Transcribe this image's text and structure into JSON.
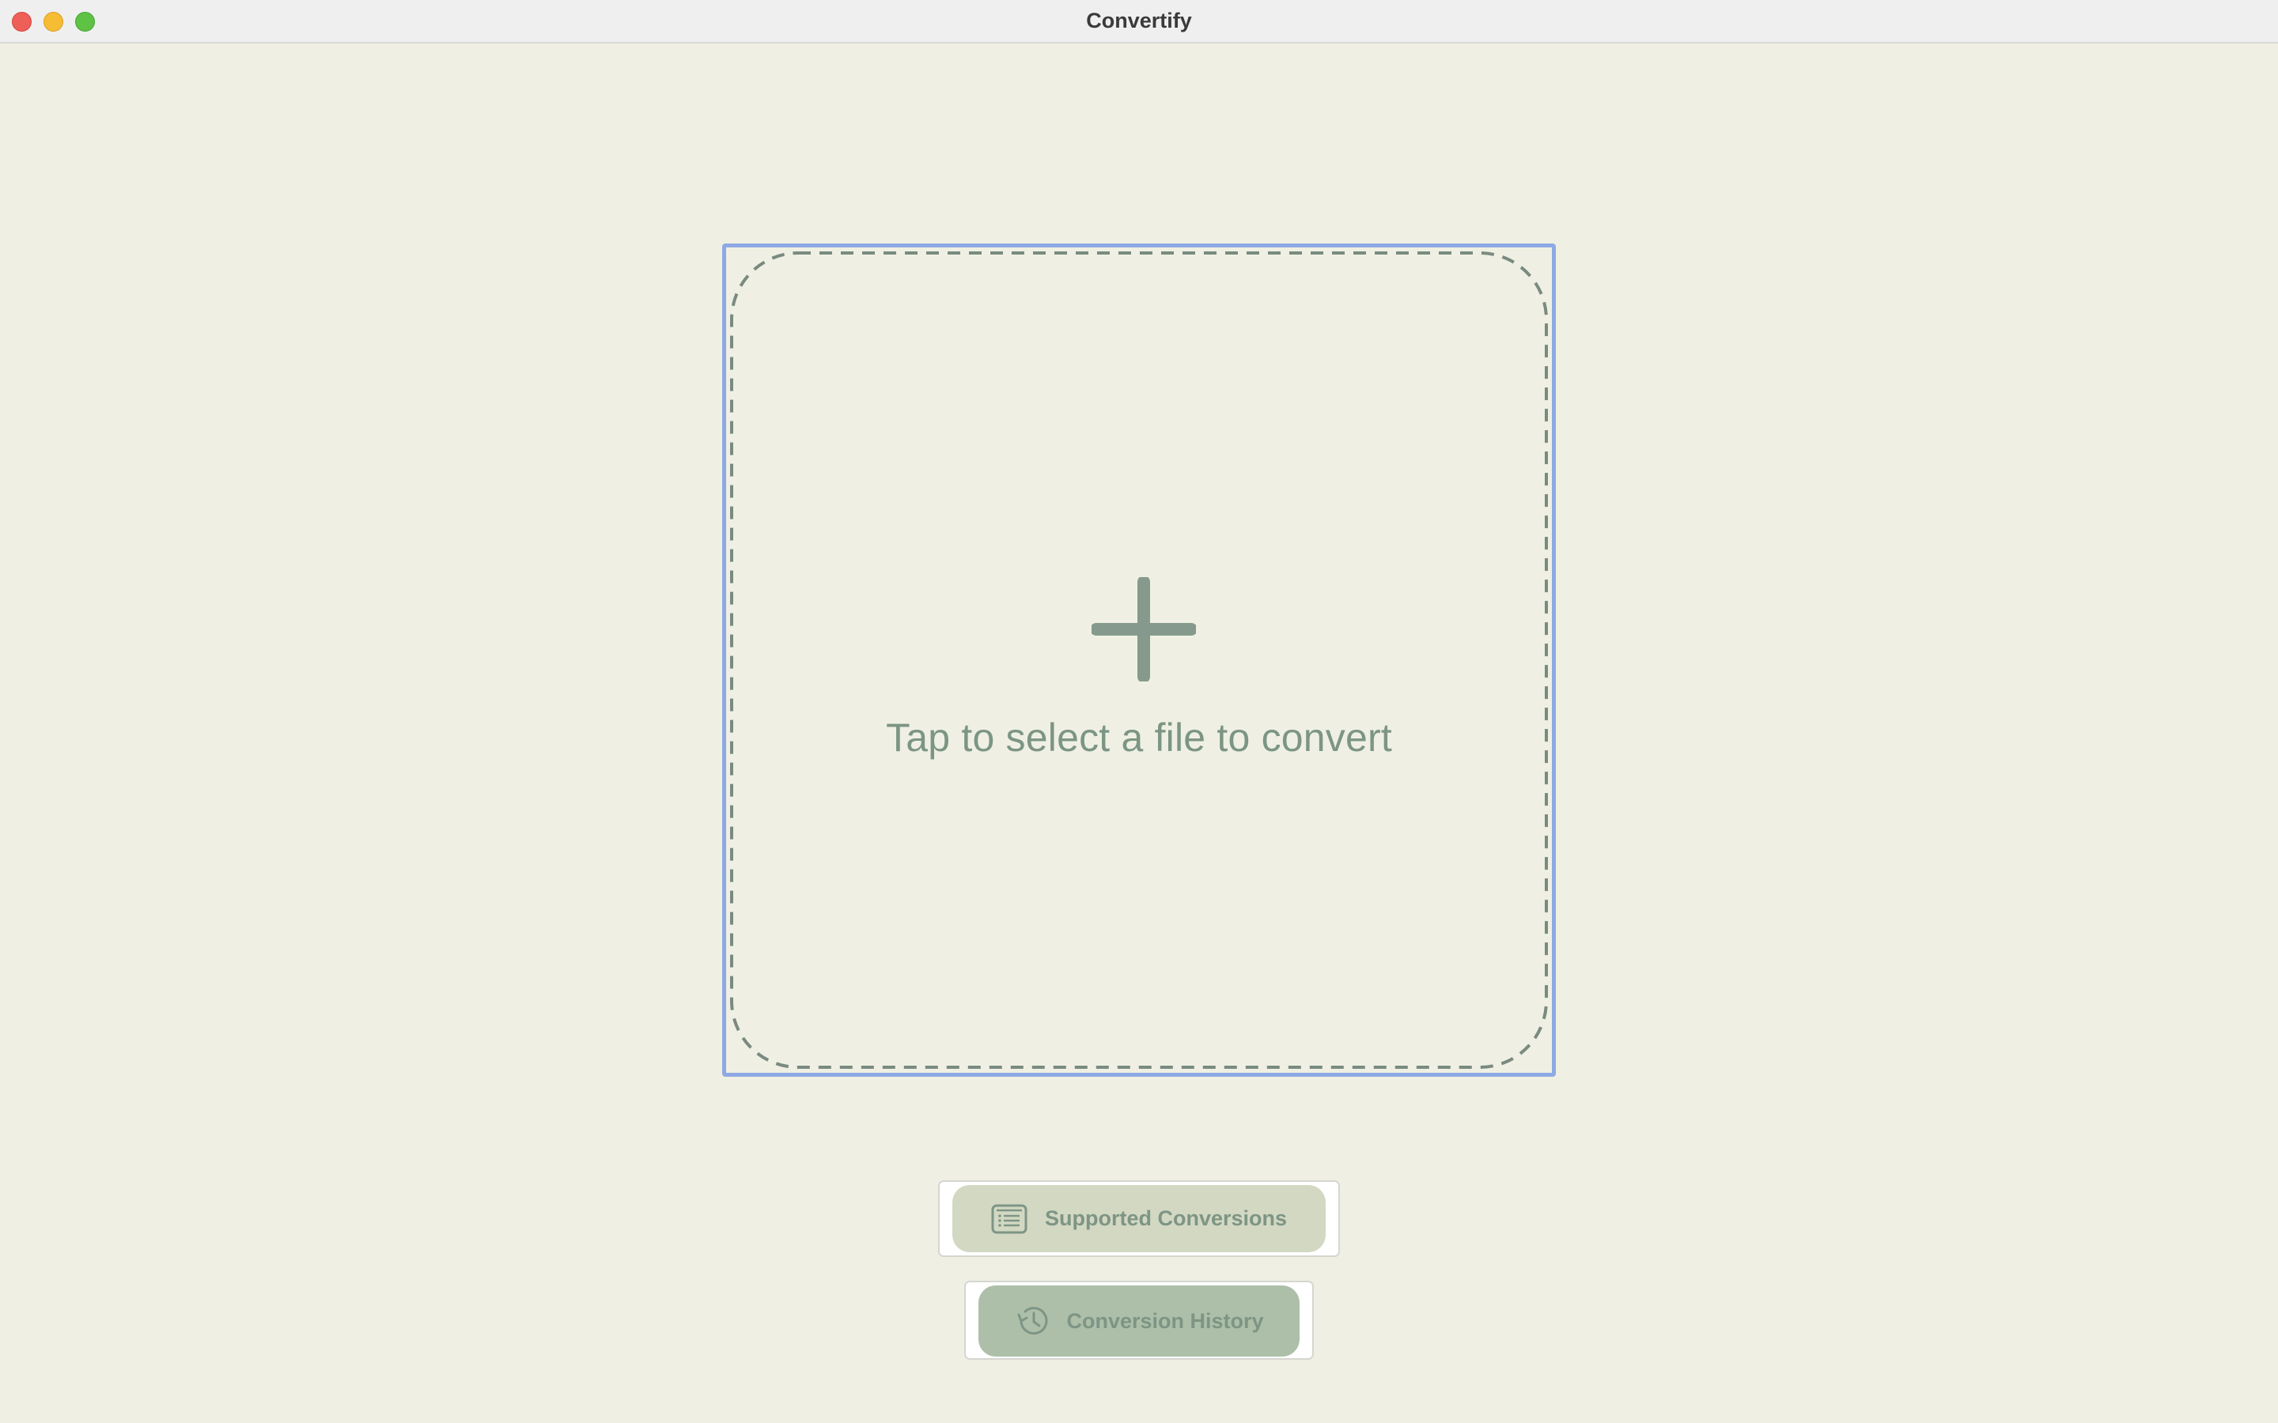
{
  "window": {
    "title": "Convertify"
  },
  "dropzone": {
    "label": "Tap to select a file to convert",
    "icon": "plus-icon"
  },
  "buttons": {
    "supported": {
      "label": "Supported Conversions",
      "icon": "list-icon"
    },
    "history": {
      "label": "Conversion History",
      "icon": "history-icon"
    }
  },
  "colors": {
    "background": "#eff0e3",
    "focus_ring": "#8ea9e3",
    "accent_text": "#7c9584",
    "supported_button_bg": "#d2d8c2",
    "history_button_bg": "#adbfa8"
  }
}
